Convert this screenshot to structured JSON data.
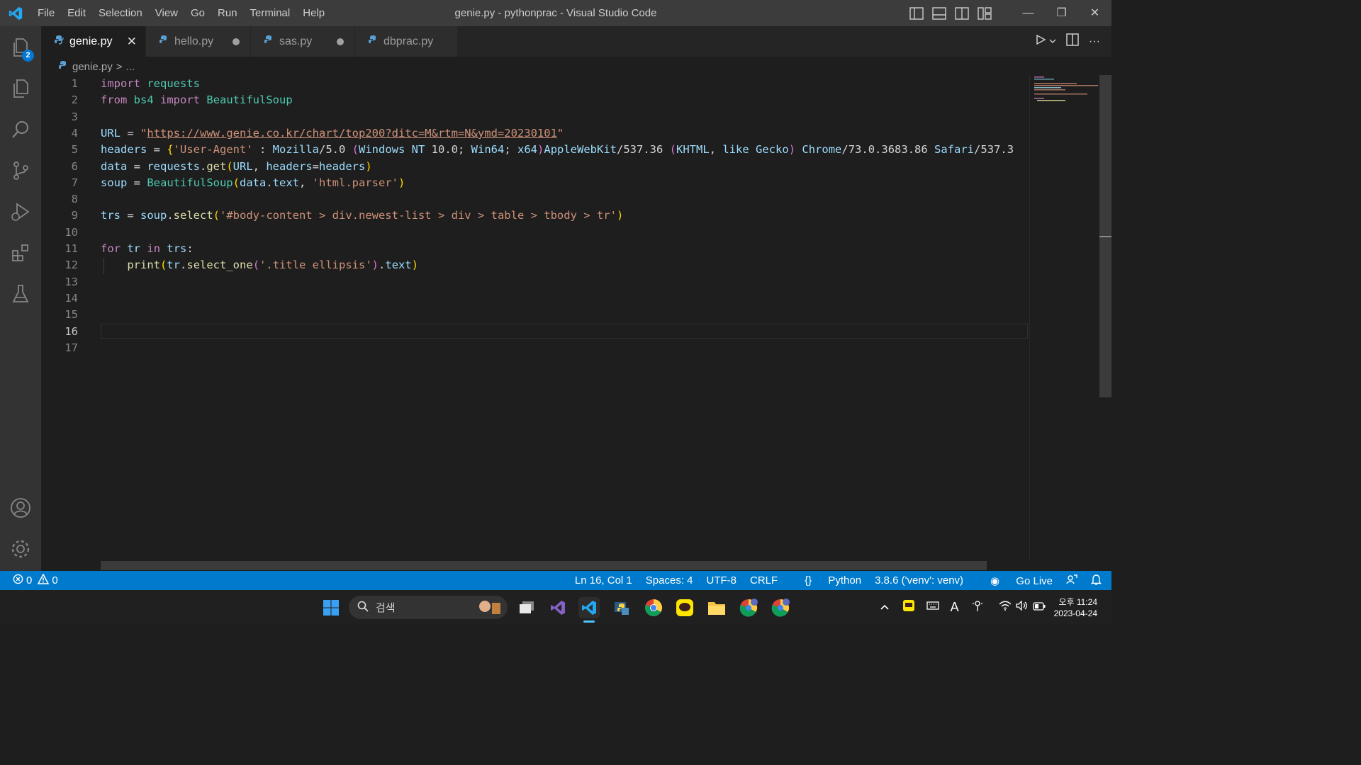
{
  "window": {
    "title": "genie.py - pythonprac - Visual Studio Code"
  },
  "menu": [
    "File",
    "Edit",
    "Selection",
    "View",
    "Go",
    "Run",
    "Terminal",
    "Help"
  ],
  "window_controls": {
    "minimize": "—",
    "restore": "❐",
    "close": "✕"
  },
  "activity_bar": {
    "explorer_badge": "2",
    "items": [
      "explorer-icon",
      "copy-files-icon",
      "search-icon",
      "source-control-icon",
      "run-debug-icon",
      "extensions-icon",
      "testing-icon"
    ],
    "bottom": [
      "account-icon",
      "settings-gear-icon"
    ]
  },
  "tabs": [
    {
      "label": "genie.py",
      "active": true,
      "state": "close"
    },
    {
      "label": "hello.py",
      "active": false,
      "state": "modified"
    },
    {
      "label": "sas.py",
      "active": false,
      "state": "modified"
    },
    {
      "label": "dbprac.py",
      "active": false,
      "state": "none"
    }
  ],
  "tab_actions": {
    "more": "···"
  },
  "breadcrumb": {
    "file": "genie.py",
    "separator": ">",
    "rest": "..."
  },
  "editor": {
    "current_line": 16,
    "line_numbers": [
      "1",
      "2",
      "3",
      "4",
      "5",
      "6",
      "7",
      "8",
      "9",
      "10",
      "11",
      "12",
      "13",
      "14",
      "15",
      "16",
      "17"
    ],
    "lines": [
      "import requests",
      "from bs4 import BeautifulSoup",
      "",
      "URL = \"https://www.genie.co.kr/chart/top200?ditc=M&rtm=N&ymd=20230101\"",
      "headers = {'User-Agent' : 'Mozilla/5.0 (Windows NT 10.0; Win64; x64)AppleWebKit/537.36 (KHTML, like Gecko) Chrome/73.0.3683.86 Safari/537.3",
      "data = requests.get(URL, headers=headers)",
      "soup = BeautifulSoup(data.text, 'html.parser')",
      "",
      "trs = soup.select('#body-content > div.newest-list > div > table > tbody > tr')",
      "",
      "for tr in trs:",
      "    print(tr.select_one('.title ellipsis').text)",
      "",
      "",
      "",
      "",
      ""
    ]
  },
  "status_bar": {
    "errors": "0",
    "warnings": "0",
    "position": "Ln 16, Col 1",
    "spaces": "Spaces: 4",
    "encoding": "UTF-8",
    "eol": "CRLF",
    "language": "Python",
    "interpreter": "3.8.6 ('venv': venv)",
    "go_live": "Go Live"
  },
  "taskbar": {
    "search_placeholder": "검색",
    "clock_time": "오후 11:24",
    "clock_date": "2023-04-24"
  },
  "colors": {
    "accent": "#007acc",
    "keyword": "#c586c0",
    "variable": "#9cdcfe",
    "class": "#4ec9b0",
    "string": "#ce9178",
    "function": "#dcdcaa"
  }
}
